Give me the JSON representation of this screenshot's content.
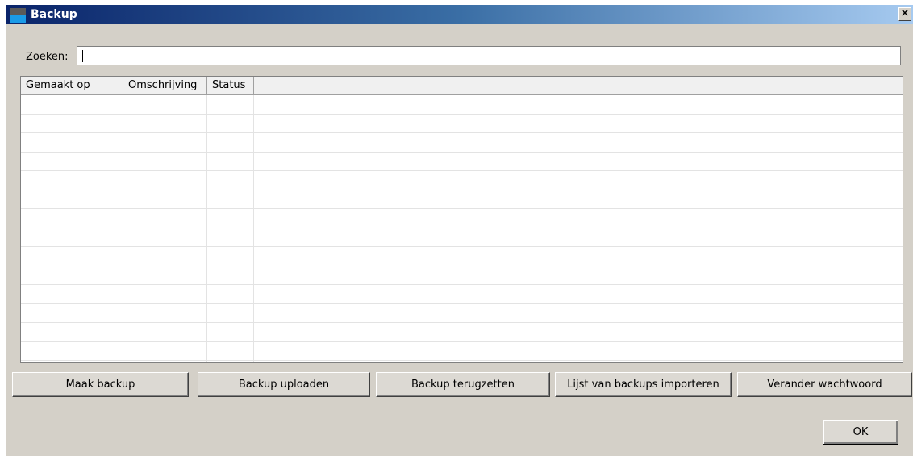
{
  "window": {
    "title": "Backup",
    "close_glyph": "×"
  },
  "search": {
    "label": "Zoeken:",
    "value": "",
    "placeholder": ""
  },
  "table": {
    "columns": [
      "Gemaakt op",
      "Omschrijving",
      "Status",
      ""
    ],
    "rows": []
  },
  "buttons": {
    "make_backup": "Maak backup",
    "upload_backup": "Backup uploaden",
    "restore_backup": "Backup terugzetten",
    "import_list": "Lijst van backups importeren",
    "change_password": "Verander wachtwoord",
    "ok": "OK"
  },
  "colors": {
    "titlebar_start": "#0a246a",
    "titlebar_end": "#a6caf0",
    "dialog_bg": "#d4d0c8"
  },
  "icons": {
    "app": "app-icon",
    "close": "close-icon"
  }
}
